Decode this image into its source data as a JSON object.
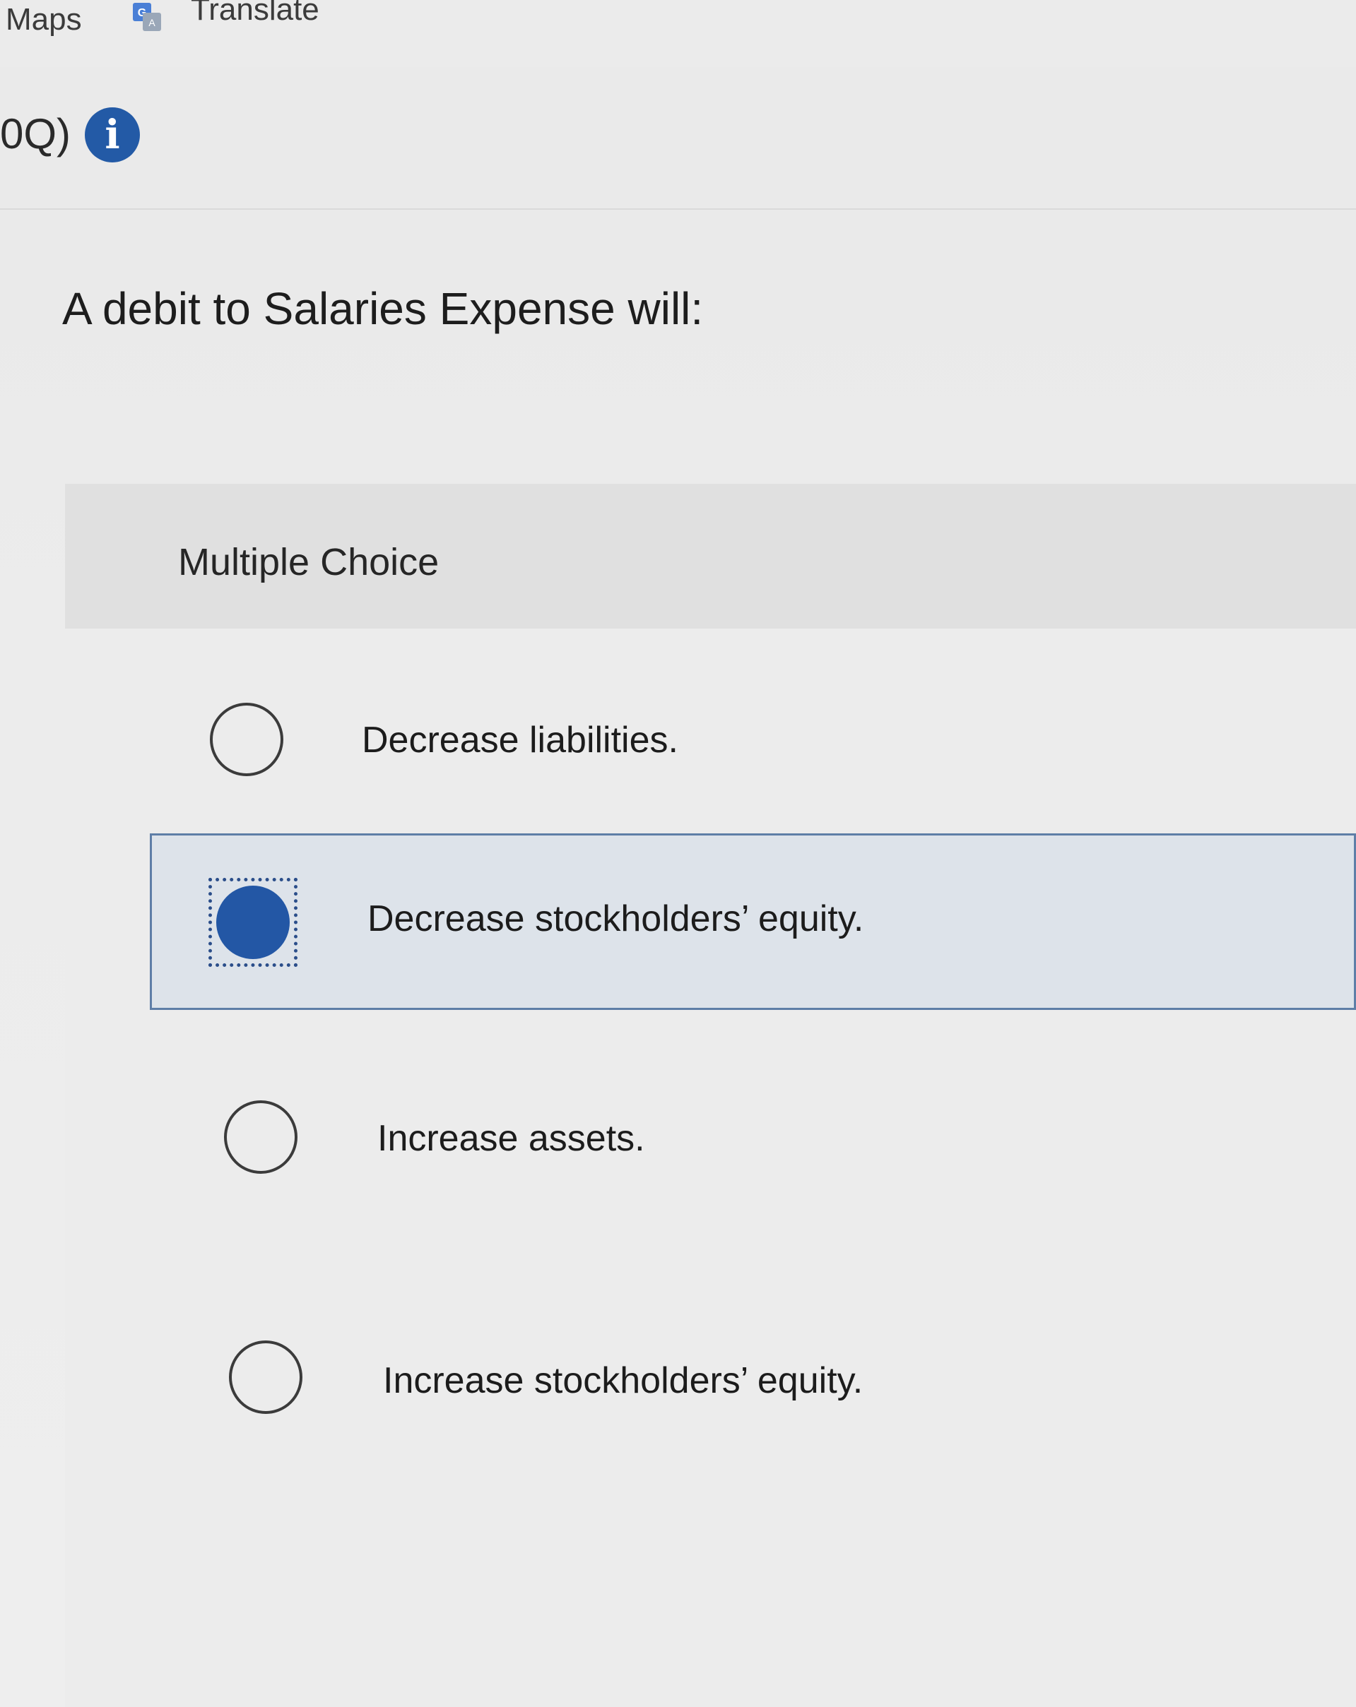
{
  "bookmarks": {
    "maps": "Maps",
    "translate": "Translate"
  },
  "question": {
    "number": "0Q)",
    "prompt": "A debit to Salaries Expense will:"
  },
  "multiple_choice": {
    "title": "Multiple Choice",
    "options": [
      {
        "label": "Decrease liabilities.",
        "selected": false
      },
      {
        "label": "Decrease stockholders’ equity.",
        "selected": true
      },
      {
        "label": "Increase assets.",
        "selected": false
      },
      {
        "label": "Increase stockholders’ equity.",
        "selected": false
      }
    ]
  },
  "colors": {
    "accent": "#2357a5",
    "selected_bg": "#dde3ea",
    "selected_border": "#5e7ea7"
  }
}
